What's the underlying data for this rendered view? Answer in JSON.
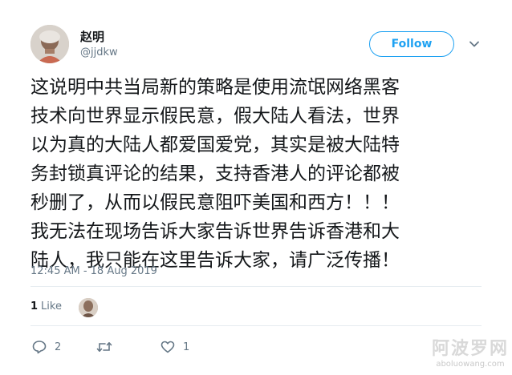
{
  "author": {
    "name": "赵明",
    "handle": "@jjdkw",
    "avatar_icon": "user-avatar-photo"
  },
  "header": {
    "follow_label": "Follow",
    "menu_icon": "chevron-down-icon",
    "accent_color": "#1da1f2"
  },
  "tweet": {
    "text": "这说明中共当局新的策略是使用流氓网络黑客\n技术向世界显示假民意，假大陆人看法，世界\n以为真的大陆人都爱国爱党，其实是被大陆特\n务封锁真评论的结果，支持香港人的评论都被\n秒删了，从而以假民意阻吓美国和西方！！！\n我无法在现场告诉大家告诉世界告诉香港和大\n陆人，我只能在这里告诉大家，请广泛传播！",
    "timestamp": "12:45 AM - 18 Aug 2019"
  },
  "stats": {
    "likes_count": "1",
    "likes_label": "Like"
  },
  "actions": {
    "reply_count": "2",
    "retweet_count": "",
    "like_count": "1"
  },
  "watermark": {
    "big": "阿波罗网",
    "small": "aboluowang.com"
  }
}
